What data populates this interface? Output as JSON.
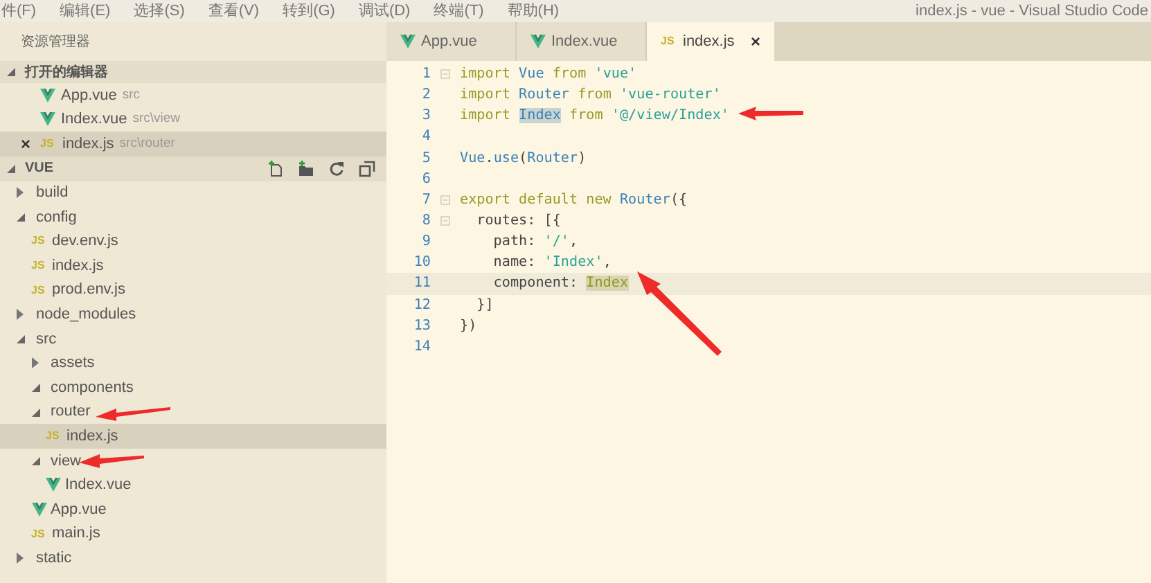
{
  "menu_bar": [
    "件(F)",
    "编辑(E)",
    "选择(S)",
    "查看(V)",
    "转到(G)",
    "调试(D)",
    "终端(T)",
    "帮助(H)"
  ],
  "window": {
    "title": "index.js - vue - Visual Studio Code"
  },
  "sidebar": {
    "title": "资源管理器",
    "open_editors": {
      "label": "打开的编辑器",
      "expanded": true,
      "items": [
        {
          "label": "App.vue",
          "path": "src",
          "kind": "vue",
          "selected": false
        },
        {
          "label": "Index.vue",
          "path": "src\\view",
          "kind": "vue",
          "selected": false
        },
        {
          "label": "index.js",
          "path": "src\\router",
          "kind": "js",
          "badge": "JS",
          "selected": true,
          "close": "×"
        }
      ]
    },
    "project": {
      "label": "VUE",
      "expanded": true,
      "tree": [
        {
          "label": "build",
          "kind": "folder",
          "expanded": false,
          "selected": false
        },
        {
          "label": "config",
          "kind": "folder",
          "expanded": true,
          "selected": false,
          "children": [
            {
              "label": "dev.env.js",
              "kind": "js",
              "badge": "JS",
              "selected": false
            },
            {
              "label": "index.js",
              "kind": "js",
              "badge": "JS",
              "selected": false
            },
            {
              "label": "prod.env.js",
              "kind": "js",
              "badge": "JS",
              "selected": false
            }
          ]
        },
        {
          "label": "node_modules",
          "kind": "folder",
          "expanded": false,
          "selected": false
        },
        {
          "label": "src",
          "kind": "folder",
          "expanded": true,
          "selected": false,
          "children": [
            {
              "label": "assets",
              "kind": "folder",
              "expanded": false,
              "selected": false
            },
            {
              "label": "components",
              "kind": "folder",
              "expanded": true,
              "selected": false
            },
            {
              "label": "router",
              "kind": "folder",
              "expanded": true,
              "selected": false,
              "children": [
                {
                  "label": "index.js",
                  "kind": "js",
                  "badge": "JS",
                  "selected": true
                }
              ]
            },
            {
              "label": "view",
              "kind": "folder",
              "expanded": true,
              "selected": false,
              "children": [
                {
                  "label": "Index.vue",
                  "kind": "vue",
                  "selected": false
                }
              ]
            },
            {
              "label": "App.vue",
              "kind": "vue",
              "selected": false
            },
            {
              "label": "main.js",
              "kind": "js",
              "badge": "JS",
              "selected": false
            }
          ]
        },
        {
          "label": "static",
          "kind": "folder",
          "expanded": false,
          "selected": false
        }
      ]
    }
  },
  "tabs": [
    {
      "label": "App.vue",
      "kind": "vue",
      "selected": false
    },
    {
      "label": "Index.vue",
      "kind": "vue",
      "selected": false
    },
    {
      "label": "index.js",
      "kind": "js",
      "badge": "JS",
      "selected": true,
      "close": "×"
    }
  ],
  "editor": {
    "lines": [
      {
        "number": "1",
        "foldable": true,
        "current": false,
        "tokens": [
          {
            "kind": "keyword",
            "text": "import"
          },
          {
            "kind": "ident",
            "text": " Vue"
          },
          {
            "kind": "keyword",
            "text": " from"
          },
          {
            "kind": "string",
            "text": " 'vue'"
          }
        ]
      },
      {
        "number": "2",
        "foldable": false,
        "current": false,
        "tokens": [
          {
            "kind": "keyword",
            "text": "import"
          },
          {
            "kind": "ident",
            "text": " Router"
          },
          {
            "kind": "keyword",
            "text": " from"
          },
          {
            "kind": "string",
            "text": " 'vue-router'"
          }
        ]
      },
      {
        "number": "3",
        "foldable": false,
        "current": false,
        "tokens": [
          {
            "kind": "keyword",
            "text": "import "
          },
          {
            "kind": "selection",
            "text": "Index"
          },
          {
            "kind": "keyword",
            "text": " from"
          },
          {
            "kind": "string",
            "text": " '@/view/Index'"
          }
        ]
      },
      {
        "number": "4",
        "foldable": false,
        "current": false
      },
      {
        "number": "5",
        "foldable": false,
        "current": false,
        "tokens": [
          {
            "kind": "ident",
            "text": "Vue"
          },
          {
            "kind": "plain",
            "text": "."
          },
          {
            "kind": "ident",
            "text": "use"
          },
          {
            "kind": "plain",
            "text": "("
          },
          {
            "kind": "ident",
            "text": "Router"
          },
          {
            "kind": "plain",
            "text": ")"
          }
        ]
      },
      {
        "number": "6",
        "foldable": false,
        "current": false
      },
      {
        "number": "7",
        "foldable": true,
        "current": false,
        "tokens": [
          {
            "kind": "keyword",
            "text": "export default new"
          },
          {
            "kind": "ident",
            "text": " Router"
          },
          {
            "kind": "plain",
            "text": "({"
          }
        ]
      },
      {
        "number": "8",
        "foldable": true,
        "current": false,
        "tokens": [
          {
            "kind": "plain",
            "text": "  routes: [{"
          }
        ]
      },
      {
        "number": "9",
        "foldable": false,
        "current": false,
        "tokens": [
          {
            "kind": "plain",
            "text": "    path: "
          },
          {
            "kind": "string",
            "text": "'/'"
          },
          {
            "kind": "plain",
            "text": ","
          }
        ]
      },
      {
        "number": "10",
        "foldable": false,
        "current": false,
        "tokens": [
          {
            "kind": "plain",
            "text": "    name: "
          },
          {
            "kind": "string",
            "text": "'Index'"
          },
          {
            "kind": "plain",
            "text": ","
          }
        ]
      },
      {
        "number": "11",
        "foldable": false,
        "current": true,
        "tokens": [
          {
            "kind": "plain",
            "text": "    component: "
          },
          {
            "kind": "occurrence",
            "text": "Index"
          }
        ]
      },
      {
        "number": "12",
        "foldable": false,
        "current": false,
        "tokens": [
          {
            "kind": "plain",
            "text": "  }]"
          }
        ]
      },
      {
        "number": "13",
        "foldable": false,
        "current": false,
        "tokens": [
          {
            "kind": "plain",
            "text": "})"
          }
        ]
      },
      {
        "number": "14",
        "foldable": false,
        "current": false
      }
    ]
  }
}
